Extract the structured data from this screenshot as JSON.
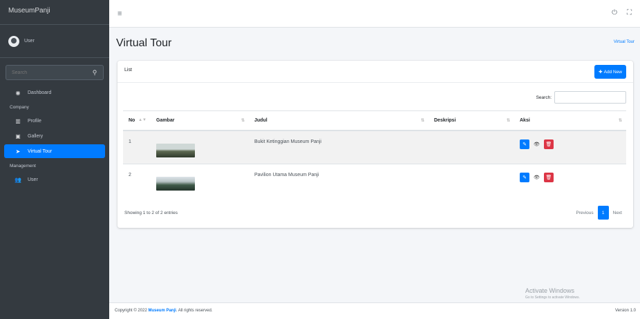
{
  "sidebar": {
    "brand": "MuseumPanji",
    "user_name": "User",
    "search_placeholder": "Search",
    "items": [
      {
        "label": "Dashboard",
        "icon": "tachometer-icon"
      },
      {
        "label": "Profile",
        "icon": "bank-icon"
      },
      {
        "label": "Gallery",
        "icon": "image-icon"
      },
      {
        "label": "Virtual Tour",
        "icon": "send-icon"
      },
      {
        "label": "User",
        "icon": "users-icon"
      }
    ],
    "headers": [
      "Company",
      "Management"
    ]
  },
  "topbar": {
    "hamburger": "≡",
    "power": "⏻",
    "expand": "⛶"
  },
  "content": {
    "title": "Virtual Tour",
    "breadcrumb": "Virtual Tour"
  },
  "card": {
    "title": "List",
    "add_label": "Add New",
    "search_label": "Search:",
    "columns": [
      "No",
      "Gambar",
      "Judul",
      "Deskripsi",
      "Aksi"
    ],
    "rows": [
      {
        "no": "1",
        "judul": "Bukit Ketinggian Museum Panji",
        "deskripsi": ""
      },
      {
        "no": "2",
        "judul": "Pavilion Utama Museum Panji",
        "deskripsi": ""
      }
    ],
    "info": "Showing 1 to 2 of 2 entries",
    "pager": {
      "prev": "Previous",
      "current": "1",
      "next": "Next"
    }
  },
  "footer": {
    "copyright": "Copyright © 2022 ",
    "brand": "Museum Panji",
    "rest": ". All rights reserved.",
    "version": "Version 1.0"
  },
  "watermark": {
    "line1": "Activate Windows",
    "line2": "Go to Settings to activate Windows."
  },
  "colors": {
    "primary": "#007bff",
    "danger": "#dc3545",
    "sidebar_bg": "#343a40"
  }
}
